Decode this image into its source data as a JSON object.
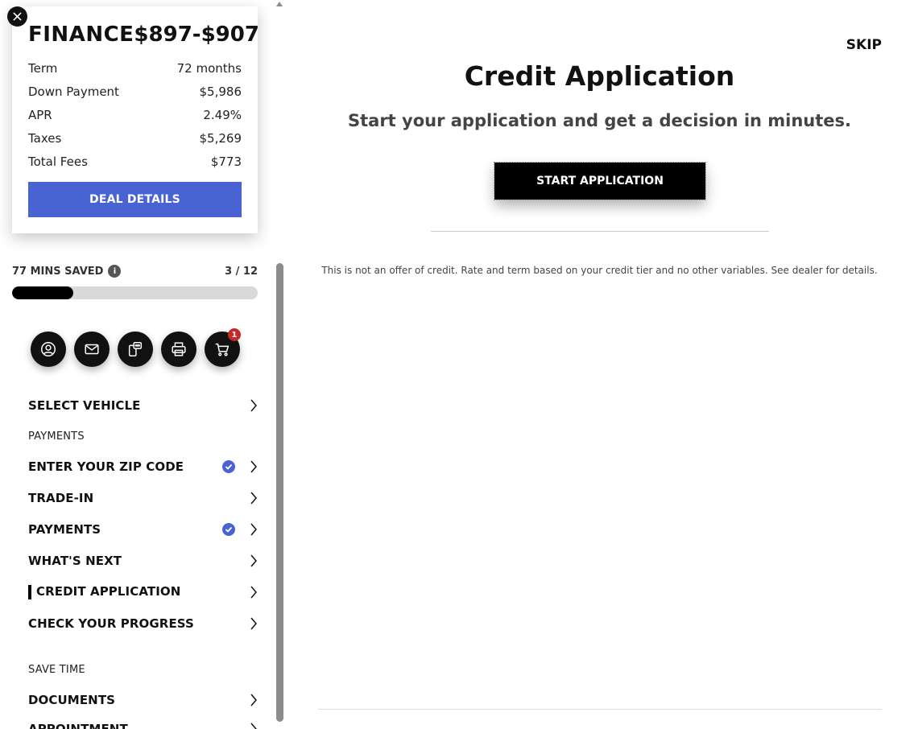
{
  "finance": {
    "title": "FINANCE",
    "price": "$897-$907",
    "rows": [
      {
        "label": "Term",
        "value": "72 months"
      },
      {
        "label": "Down Payment",
        "value": "$5,986"
      },
      {
        "label": "APR",
        "value": "2.49%"
      },
      {
        "label": "Taxes",
        "value": "$5,269"
      },
      {
        "label": "Total Fees",
        "value": "$773"
      }
    ],
    "deal_button": "DEAL DETAILS"
  },
  "progress": {
    "mins_saved": "77 MINS SAVED",
    "info_icon": "i",
    "step_count": "3 / 12",
    "fraction": 0.25
  },
  "actions": {
    "icons": [
      "user-icon",
      "mail-icon",
      "sms-icon",
      "print-icon",
      "cart-icon"
    ],
    "cart_badge": "1"
  },
  "nav": {
    "select_vehicle": "SELECT VEHICLE",
    "payments_section": "PAYMENTS",
    "enter_zip": "ENTER YOUR ZIP CODE",
    "trade_in": "TRADE-IN",
    "payments": "PAYMENTS",
    "whats_next": "WHAT'S NEXT",
    "credit_application": "CREDIT APPLICATION",
    "check_progress": "CHECK YOUR PROGRESS",
    "save_time_section": "SAVE TIME",
    "documents": "DOCUMENTS",
    "appointment": "APPOINTMENT"
  },
  "main": {
    "skip": "SKIP",
    "title": "Credit Application",
    "subtitle": "Start your application and get a decision in minutes.",
    "start_button": "START APPLICATION",
    "disclaimer": "This is not an offer of credit. Rate and term based on your credit tier and no other variables. See dealer for details."
  },
  "colors": {
    "accent": "#4a63d3",
    "badge": "#c62828",
    "primary": "#000000"
  }
}
